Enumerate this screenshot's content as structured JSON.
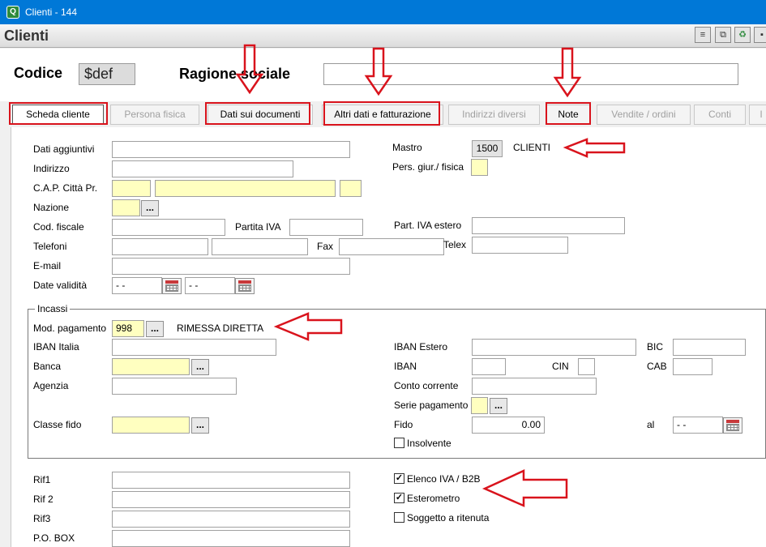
{
  "window": {
    "title": "Clienti - 144",
    "app_icon_glyph": "Q"
  },
  "header": {
    "title": "Clienti",
    "toolbar_icons": [
      "notes-icon",
      "copy-icon",
      "recycle-bin-icon",
      "save-icon"
    ]
  },
  "top": {
    "code_label": "Codice",
    "code_value": "$def",
    "ragione_label": "Ragione sociale",
    "ragione_value": ""
  },
  "tabs": [
    {
      "label": "Scheda cliente",
      "state": "active",
      "highlighted": true
    },
    {
      "label": "Persona fisica",
      "state": "disabled",
      "highlighted": false
    },
    {
      "label": "Dati sui documenti",
      "state": "enabled",
      "highlighted": true
    },
    {
      "label": "Altri dati e fatturazione",
      "state": "enabled",
      "highlighted": true
    },
    {
      "label": "Indirizzi diversi",
      "state": "disabled",
      "highlighted": false
    },
    {
      "label": "Note",
      "state": "enabled",
      "highlighted": true
    },
    {
      "label": "Vendite / ordini",
      "state": "disabled",
      "highlighted": false
    },
    {
      "label": "Conti",
      "state": "disabled",
      "highlighted": false
    },
    {
      "label": "I",
      "state": "disabled",
      "highlighted": false
    }
  ],
  "form": {
    "dati_aggiuntivi": {
      "label": "Dati aggiuntivi",
      "value": ""
    },
    "indirizzo": {
      "label": "Indirizzo",
      "value": ""
    },
    "cap_citta_pr": {
      "label": "C.A.P.  Città  Pr.",
      "cap": "",
      "citta": "",
      "pr": ""
    },
    "nazione": {
      "label": "Nazione",
      "value": "",
      "button": "..."
    },
    "cod_fiscale": {
      "label": "Cod. fiscale",
      "value": ""
    },
    "partita_iva": {
      "label": "Partita IVA",
      "value": ""
    },
    "telefoni": {
      "label": "Telefoni",
      "value1": "",
      "value2": ""
    },
    "fax": {
      "label": "Fax",
      "value": ""
    },
    "telex": {
      "label": "Telex",
      "value": ""
    },
    "email": {
      "label": "E-mail",
      "value": ""
    },
    "date_validita": {
      "label": "Date validità",
      "from": "- -",
      "to": "- -"
    },
    "mastro": {
      "label": "Mastro",
      "value": "1500",
      "desc": "CLIENTI"
    },
    "pers_giur_fisica": {
      "label": "Pers. giur./ fisica",
      "value": ""
    },
    "part_iva_estero": {
      "label": "Part. IVA estero",
      "value": ""
    }
  },
  "incassi": {
    "title": "Incassi",
    "mod_pagamento": {
      "label": "Mod. pagamento",
      "value": "998",
      "button": "...",
      "desc": "RIMESSA DIRETTA"
    },
    "iban_italia": {
      "label": "IBAN Italia",
      "value": ""
    },
    "banca": {
      "label": "Banca",
      "value": "",
      "button": "..."
    },
    "agenzia": {
      "label": "Agenzia",
      "value": ""
    },
    "classe_fido": {
      "label": "Classe fido",
      "value": "",
      "button": "..."
    },
    "iban_estero": {
      "label": "IBAN Estero",
      "value": ""
    },
    "bic": {
      "label": "BIC",
      "value": ""
    },
    "iban": {
      "label": "IBAN",
      "value": ""
    },
    "cin": {
      "label": "CIN",
      "value": ""
    },
    "cab": {
      "label": "CAB",
      "value": ""
    },
    "conto_corrente": {
      "label": "Conto corrente",
      "value": ""
    },
    "serie_pagamento": {
      "label": "Serie pagamento",
      "value": "",
      "button": "..."
    },
    "fido": {
      "label": "Fido",
      "value": "0.00"
    },
    "al": {
      "label": "al",
      "value": "- -"
    },
    "insolvente": {
      "label": "Insolvente",
      "checked": false
    }
  },
  "bottom": {
    "rif1": {
      "label": "Rif1",
      "value": ""
    },
    "rif2": {
      "label": "Rif 2",
      "value": ""
    },
    "rif3": {
      "label": "Rif3",
      "value": ""
    },
    "po_box": {
      "label": "P.O. BOX",
      "value": ""
    },
    "elenco_iva": {
      "label": "Elenco IVA / B2B",
      "checked": true,
      "mark": "✓"
    },
    "esterometro": {
      "label": "Esterometro",
      "checked": true,
      "mark": "✓"
    },
    "soggetto_ritenuta": {
      "label": "Soggetto a ritenuta",
      "checked": false,
      "mark": ""
    }
  },
  "annotations": {
    "color": "#d9131c",
    "items": [
      "tab-box-scheda-cliente",
      "tab-box-dati-documenti",
      "tab-box-altri-dati",
      "tab-box-note",
      "arrow-dati-documenti",
      "arrow-altri-dati",
      "arrow-note",
      "arrow-clienti",
      "arrow-rimessa-diretta",
      "arrow-elenco-iva"
    ]
  }
}
